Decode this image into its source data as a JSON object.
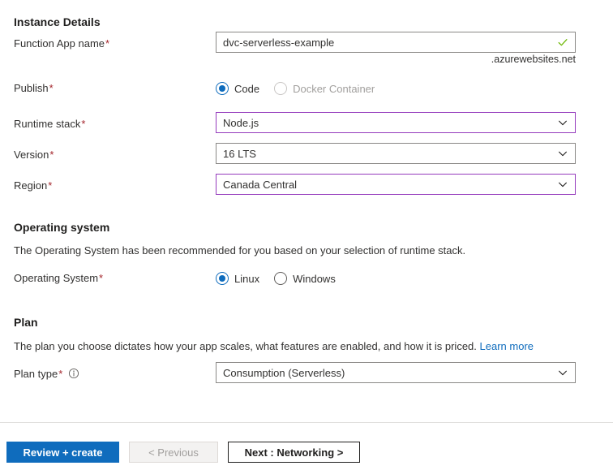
{
  "sections": {
    "instance_details": {
      "heading": "Instance Details",
      "fields": {
        "app_name": {
          "label": "Function App name",
          "required_marker": "*",
          "value": "dvc-serverless-example",
          "placeholder": "",
          "suffix": ".azurewebsites.net",
          "validation_icon": "check-icon",
          "validation_color": "#6bb700"
        },
        "publish": {
          "label": "Publish",
          "required_marker": "*",
          "selected": "Code",
          "options": [
            {
              "label": "Code",
              "selected": true,
              "disabled": false
            },
            {
              "label": "Docker Container",
              "selected": false,
              "disabled": true
            }
          ]
        },
        "runtime_stack": {
          "label": "Runtime stack",
          "required_marker": "*",
          "value": "Node.js",
          "border": "accent"
        },
        "version": {
          "label": "Version",
          "required_marker": "*",
          "value": "16 LTS",
          "border": "normal"
        },
        "region": {
          "label": "Region",
          "required_marker": "*",
          "value": "Canada Central",
          "border": "accent"
        }
      }
    },
    "operating_system": {
      "heading": "Operating system",
      "description": "The Operating System has been recommended for you based on your selection of runtime stack.",
      "fields": {
        "os": {
          "label": "Operating System",
          "required_marker": "*",
          "selected": "Linux",
          "options": [
            {
              "label": "Linux",
              "selected": true,
              "disabled": false
            },
            {
              "label": "Windows",
              "selected": false,
              "disabled": false
            }
          ]
        }
      }
    },
    "plan": {
      "heading": "Plan",
      "description": "The plan you choose dictates how your app scales, what features are enabled, and how it is priced.",
      "learn_more": "Learn more",
      "fields": {
        "plan_type": {
          "label": "Plan type",
          "required_marker": "*",
          "info_icon": "info-icon",
          "value": "Consumption (Serverless)",
          "border": "normal"
        }
      }
    }
  },
  "footer": {
    "review_create": "Review + create",
    "previous": "< Previous",
    "next": "Next : Networking >"
  },
  "colors": {
    "accent_blue": "#0f6cbd",
    "accent_purple": "#963cbd",
    "required_red": "#a4262c",
    "success_green": "#6bb700",
    "link_blue": "#0f6cbd"
  }
}
